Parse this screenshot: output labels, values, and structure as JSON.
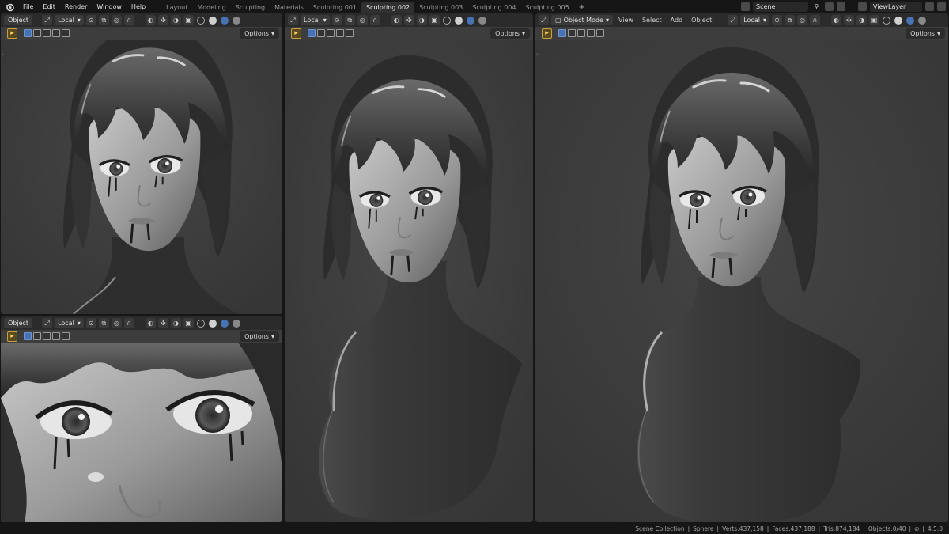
{
  "menus": [
    "File",
    "Edit",
    "Render",
    "Window",
    "Help"
  ],
  "workspace_tabs": [
    "Layout",
    "Modeling",
    "Sculpting",
    "Materials",
    "Sculpting.001",
    "Sculpting.002",
    "Sculpting.003",
    "Sculpting.004",
    "Sculpting.005"
  ],
  "active_tab": "Sculpting.002",
  "scene": "Scene",
  "view_layer": "ViewLayer",
  "editors": {
    "top_left": {
      "mode": "Object",
      "orientation": "Local",
      "options": "Options"
    },
    "bottom_left": {
      "mode": "Object",
      "orientation": "Local",
      "options": "Options"
    },
    "middle": {
      "orientation": "Local",
      "options": "Options"
    },
    "right": {
      "mode": "Object Mode",
      "menus": [
        "View",
        "Select",
        "Add",
        "Object"
      ],
      "orientation": "Local",
      "options": "Options"
    }
  },
  "status": {
    "collection": "Scene Collection",
    "object": "Sphere",
    "verts": "Verts:437,158",
    "faces": "Faces:437,188",
    "tris": "Tris:874,184",
    "objects": "Objects:0/40",
    "version": "4.5.0"
  },
  "colors": {
    "accent": "#4772b3",
    "viewport_bg": "#3d3d3d",
    "header_bg": "#2b2b2b",
    "tool_active": "#c8a040"
  },
  "icons": [
    "blender-logo-icon",
    "transform-icon",
    "snap-icon",
    "proportional-icon",
    "overlay-icon",
    "shading-wireframe-icon",
    "shading-solid-icon",
    "shading-material-icon",
    "shading-rendered-icon",
    "select-tool-icon",
    "pin-icon",
    "new-scene-icon",
    "delete-icon"
  ]
}
